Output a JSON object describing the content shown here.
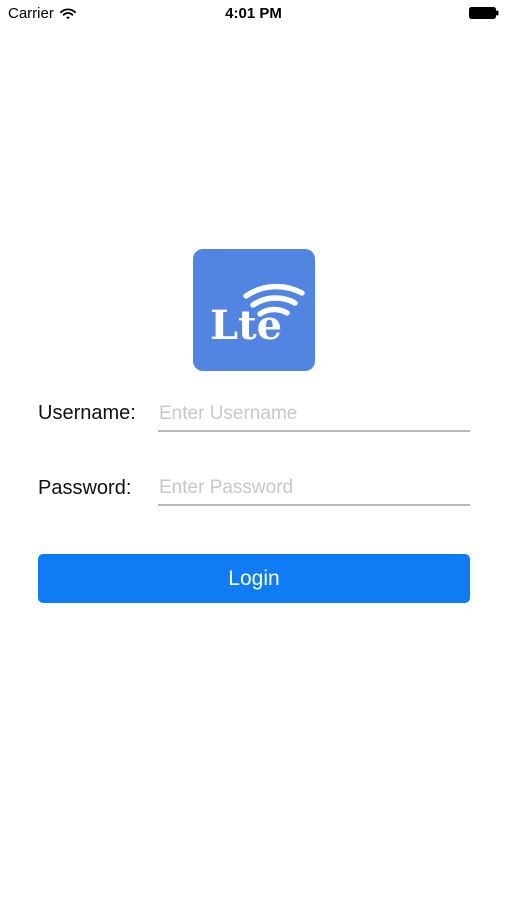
{
  "status_bar": {
    "carrier": "Carrier",
    "time": "4:01 PM",
    "wifi_icon": "wifi-icon",
    "battery_icon": "battery-full-icon"
  },
  "logo": {
    "text": "Lte",
    "icon": "lte-signal-icon",
    "background_color": "#5185e1"
  },
  "form": {
    "username": {
      "label": "Username:",
      "placeholder": "Enter Username",
      "value": ""
    },
    "password": {
      "label": "Password:",
      "placeholder": "Enter Password",
      "value": ""
    },
    "login_label": "Login"
  },
  "colors": {
    "accent": "#0f7cf5",
    "placeholder": "#c7c7cd",
    "underline": "#b8b8b8"
  }
}
